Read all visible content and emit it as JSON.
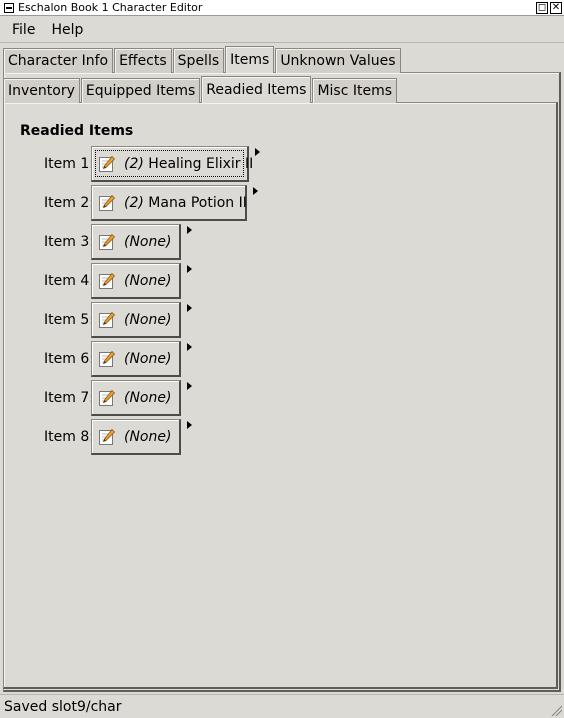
{
  "window": {
    "title": "Eschalon Book 1 Character Editor"
  },
  "menu": {
    "file": "File",
    "help": "Help"
  },
  "tabs": [
    "Character Info",
    "Effects",
    "Spells",
    "Items",
    "Unknown Values"
  ],
  "active_tab": "Items",
  "subtabs": [
    "Inventory",
    "Equipped Items",
    "Readied Items",
    "Misc Items"
  ],
  "active_subtab": "Readied Items",
  "section_title": "Readied Items",
  "slots": [
    {
      "label": "Item 1:",
      "qty": "(2)",
      "name": "Healing Elixir II"
    },
    {
      "label": "Item 2:",
      "qty": "(2)",
      "name": "Mana Potion II"
    },
    {
      "label": "Item 3:",
      "qty": "",
      "name": "(None)"
    },
    {
      "label": "Item 4:",
      "qty": "",
      "name": "(None)"
    },
    {
      "label": "Item 5:",
      "qty": "",
      "name": "(None)"
    },
    {
      "label": "Item 6:",
      "qty": "",
      "name": "(None)"
    },
    {
      "label": "Item 7:",
      "qty": "",
      "name": "(None)"
    },
    {
      "label": "Item 8:",
      "qty": "",
      "name": "(None)"
    }
  ],
  "icons": {
    "slot_edit": "edit-pencil-icon",
    "slot_menu": "menu-arrow-icon"
  },
  "status": "Saved slot9/char"
}
